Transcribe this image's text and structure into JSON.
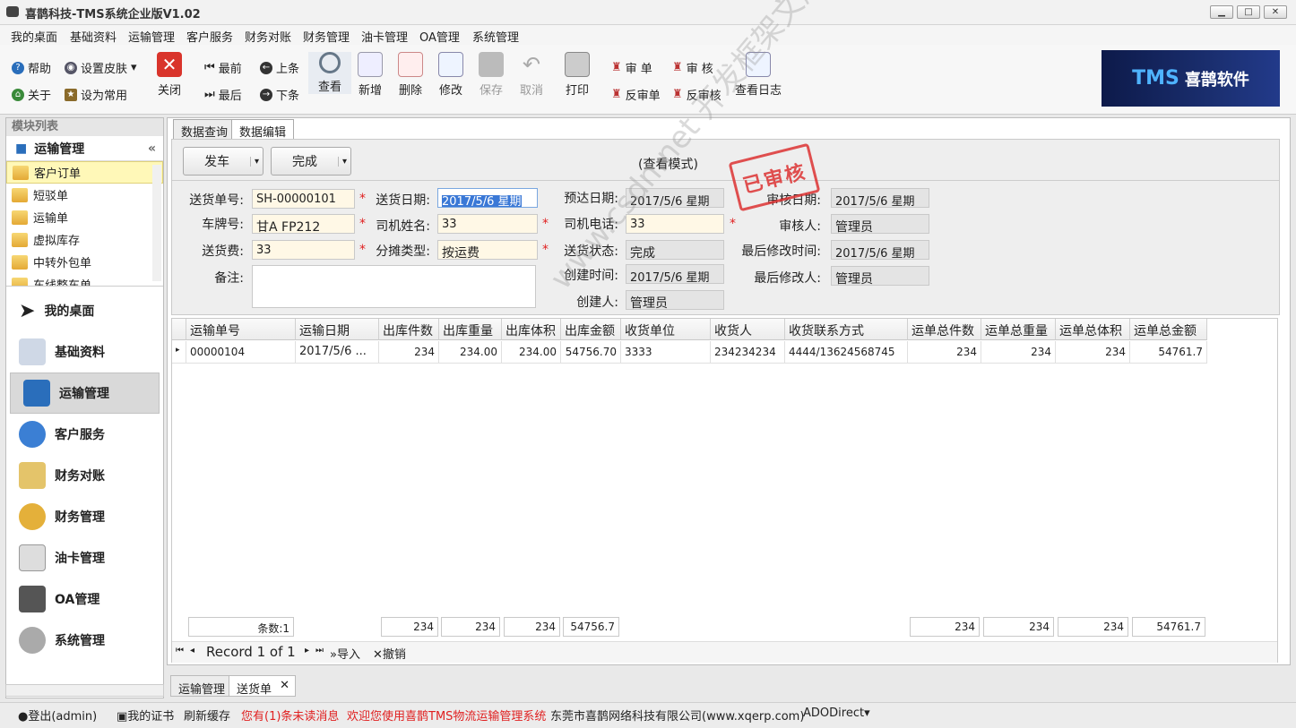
{
  "window": {
    "title": "喜鹊科技-TMS系统企业版V1.02",
    "min": "▁",
    "max": "□",
    "close": "✕"
  },
  "menu": [
    "我的桌面",
    "基础资料",
    "运输管理",
    "客户服务",
    "财务对账",
    "财务管理",
    "油卡管理",
    "OA管理",
    "系统管理"
  ],
  "toolbar": {
    "help": "帮助",
    "skin": "设置皮肤",
    "about": "关于",
    "favorite": "设为常用",
    "close": "关闭",
    "first": "最前",
    "last": "最后",
    "prev": "上条",
    "next": "下条",
    "view": "查看",
    "add": "新增",
    "delete": "删除",
    "edit": "修改",
    "save": "保存",
    "cancel": "取消",
    "print": "打印",
    "audit_doc": "审 单",
    "audit": "审 核",
    "unaudit_doc": "反审单",
    "unaudit": "反审核",
    "log": "查看日志",
    "logo_tms": "TMS",
    "logo_text": "喜鹊软件"
  },
  "left": {
    "header": "模块列表",
    "section": "运输管理",
    "collapse": "«",
    "modules": [
      "客户订单",
      "短驳单",
      "运输单",
      "虚拟库存",
      "中转外包单",
      "车线整车单"
    ],
    "selected_module": "客户订单",
    "nav": [
      "我的桌面",
      "基础资料",
      "运输管理",
      "客户服务",
      "财务对账",
      "财务管理",
      "油卡管理",
      "OA管理",
      "系统管理"
    ],
    "selected_nav": "运输管理"
  },
  "tabs": {
    "query": "数据查询",
    "edit": "数据编辑"
  },
  "form": {
    "depart_btn": "发车",
    "finish_btn": "完成",
    "mode": "(查看模式)",
    "stamp": "已审核",
    "fields": {
      "delivery_no": {
        "label": "送货单号:",
        "value": "SH-00000101"
      },
      "delivery_date": {
        "label": "送货日期:",
        "value": "2017/5/6 星期"
      },
      "eta": {
        "label": "预达日期:",
        "value": "2017/5/6 星期"
      },
      "audit_date": {
        "label": "审核日期:",
        "value": "2017/5/6 星期"
      },
      "plate": {
        "label": "车牌号:",
        "value": "甘A FP212"
      },
      "driver": {
        "label": "司机姓名:",
        "value": "33"
      },
      "driver_phone": {
        "label": "司机电话:",
        "value": "33"
      },
      "auditor": {
        "label": "审核人:",
        "value": "管理员"
      },
      "fee": {
        "label": "送货费:",
        "value": "33"
      },
      "split_type": {
        "label": "分摊类型:",
        "value": "按运费"
      },
      "status": {
        "label": "送货状态:",
        "value": "完成"
      },
      "last_modified": {
        "label": "最后修改时间:",
        "value": "2017/5/6 星期"
      },
      "remark": {
        "label": "备注:",
        "value": ""
      },
      "created_time": {
        "label": "创建时间:",
        "value": "2017/5/6 星期"
      },
      "last_modifier": {
        "label": "最后修改人:",
        "value": "管理员"
      },
      "creator": {
        "label": "创建人:",
        "value": "管理员"
      }
    }
  },
  "grid": {
    "columns": [
      "运输单号",
      "运输日期",
      "出库件数",
      "出库重量",
      "出库体积",
      "出库金额",
      "收货单位",
      "收货人",
      "收货联系方式",
      "运单总件数",
      "运单总重量",
      "运单总体积",
      "运单总金额"
    ],
    "rows": [
      [
        "00000104",
        "2017/5/6 ...",
        "234",
        "234.00",
        "234.00",
        "54756.70",
        "3333",
        "234234234",
        "4444/13624568745",
        "234",
        "234",
        "234",
        "54761.7"
      ]
    ],
    "footer": {
      "count": "条数:1",
      "qty": "234",
      "weight": "234",
      "volume": "234",
      "amount": "54756.7",
      "tqty": "234",
      "tweight": "234",
      "tvolume": "234",
      "tamount": "54761.7"
    },
    "nav_record": "Record 1 of 1",
    "import": "导入",
    "void": "撤销"
  },
  "bottom_tabs": [
    "运输管理",
    "送货单"
  ],
  "status": {
    "logout": "登出(admin)",
    "cert": "我的证书",
    "refresh": "刷新缓存",
    "unread": "您有(1)条未读消息",
    "welcome": "欢迎您使用喜鹊TMS物流运输管理系统",
    "company": "东莞市喜鹊网络科技有限公司(www.xqerp.com)",
    "conn": "ADODirect"
  },
  "watermark": "www.csdn.net 开发框架文库",
  "colors": {
    "accent": "#2a6ebb",
    "required": "#e02020",
    "stamp": "#dd3333",
    "selected_row": "#fff8b8",
    "input_bg": "#fff8e6"
  }
}
